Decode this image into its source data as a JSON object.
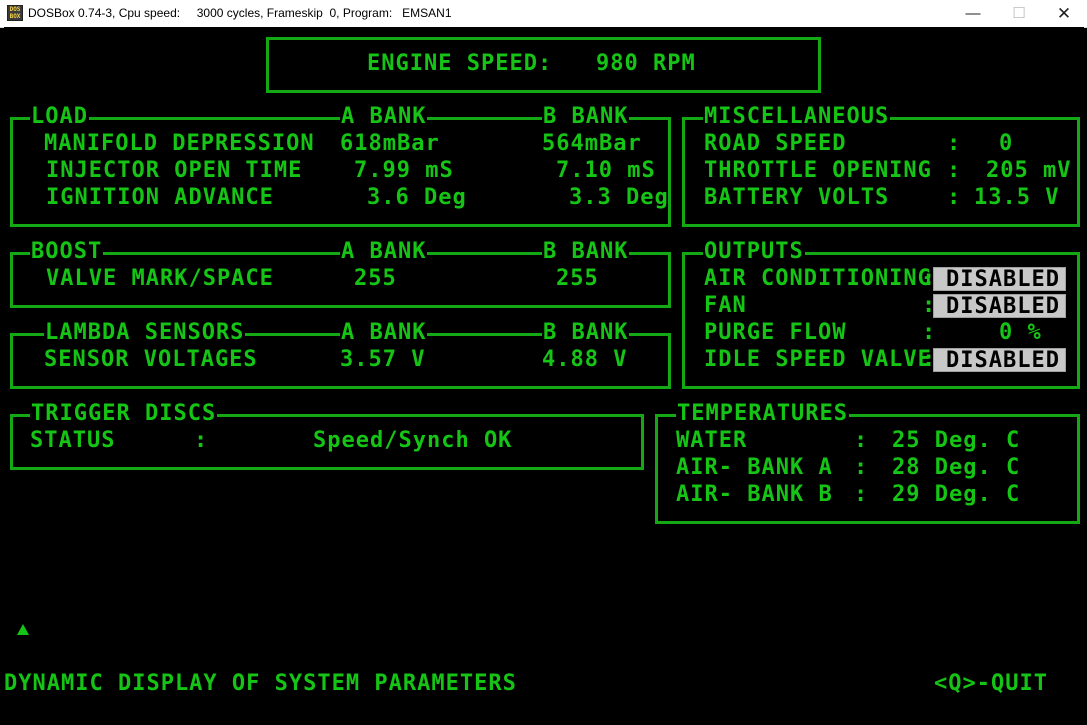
{
  "window": {
    "title": "DOSBox 0.74-3, Cpu speed:     3000 cycles, Frameskip  0, Program:   EMSAN1",
    "icon": "dosbox-icon"
  },
  "engine": {
    "label": "ENGINE SPEED:",
    "value": "980 RPM"
  },
  "load": {
    "title": "LOAD",
    "col_a": "A BANK",
    "col_b": "B BANK",
    "rows": [
      {
        "label": "MANIFOLD DEPRESSION",
        "a": "618mBar",
        "b": "564mBar"
      },
      {
        "label": "INJECTOR OPEN TIME",
        "a": "7.99 mS",
        "b": "7.10 mS"
      },
      {
        "label": "IGNITION ADVANCE",
        "a": "3.6 Deg",
        "b": "3.3 Deg"
      }
    ]
  },
  "misc": {
    "title": "MISCELLANEOUS",
    "rows": [
      {
        "label": "ROAD SPEED",
        "sep": ":",
        "value": "0"
      },
      {
        "label": "THROTTLE OPENING",
        "sep": ":",
        "value": "205 mV"
      },
      {
        "label": "BATTERY VOLTS",
        "sep": ":",
        "value": "13.5 V"
      }
    ]
  },
  "boost": {
    "title": "BOOST",
    "col_a": "A BANK",
    "col_b": "B BANK",
    "row": {
      "label": "VALVE MARK/SPACE",
      "a": "255",
      "b": "255"
    }
  },
  "outputs": {
    "title": "OUTPUTS",
    "rows": [
      {
        "label": "AIR CONDITIONING",
        "sep": ":",
        "value": "DISABLED"
      },
      {
        "label": "FAN",
        "sep": ":",
        "value": "DISABLED"
      },
      {
        "label": "PURGE FLOW",
        "sep": ":",
        "value": "0 %"
      },
      {
        "label": "IDLE SPEED VALVE",
        "sep": ":",
        "value": "DISABLED"
      }
    ]
  },
  "lambda": {
    "title": "LAMBDA SENSORS",
    "col_a": "A BANK",
    "col_b": "B BANK",
    "row": {
      "label": "SENSOR VOLTAGES",
      "a": "3.57 V",
      "b": "4.88 V"
    }
  },
  "trigger": {
    "title": "TRIGGER DISCS",
    "label": "STATUS",
    "sep": ":",
    "value": "Speed/Synch OK"
  },
  "temps": {
    "title": "TEMPERATURES",
    "rows": [
      {
        "label": "WATER",
        "sep": ":",
        "value": "25 Deg. C"
      },
      {
        "label": "AIR- BANK A",
        "sep": ":",
        "value": "28 Deg. C"
      },
      {
        "label": "AIR- BANK B",
        "sep": ":",
        "value": "29 Deg. C"
      }
    ]
  },
  "footer": {
    "status": "DYNAMIC DISPLAY OF SYSTEM PARAMETERS",
    "quit": "<Q>-QUIT"
  },
  "colors": {
    "text": "#15c415",
    "border": "#15a815",
    "background": "#000000",
    "badge": "#c8c8c8"
  }
}
